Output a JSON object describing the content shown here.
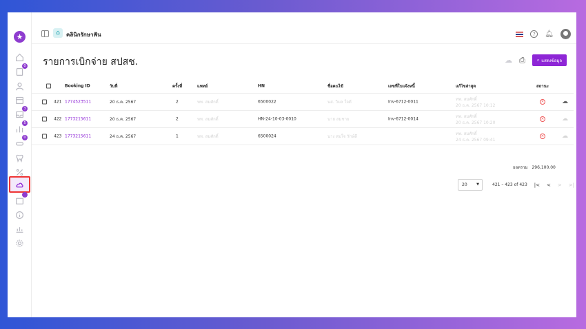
{
  "app": {
    "clinic_name": "คลินิกรักษาฟัน",
    "logo_glyph": "★",
    "clinic_icon": "⌂"
  },
  "sidebar": {
    "items": [
      {
        "icon": "home-icon",
        "badge": ""
      },
      {
        "icon": "document-icon",
        "badge": "0"
      },
      {
        "icon": "user-icon",
        "badge": ""
      },
      {
        "icon": "calendar-icon",
        "badge": ""
      },
      {
        "icon": "inbox-icon",
        "badge": "3"
      },
      {
        "icon": "chart-icon",
        "badge": "5"
      },
      {
        "icon": "pill-icon",
        "badge": "0"
      },
      {
        "icon": "tooth-icon",
        "badge": ""
      },
      {
        "icon": "percent-icon",
        "badge": ""
      },
      {
        "icon": "cloud-icon",
        "badge": "",
        "active": true
      },
      {
        "icon": "box-icon",
        "badge": ""
      },
      {
        "icon": "info-icon",
        "badge": ""
      },
      {
        "icon": "report-icon",
        "badge": ""
      },
      {
        "icon": "settings-icon",
        "badge": ""
      }
    ]
  },
  "page": {
    "title": "รายการเบิกจ่าย สปสช.",
    "search_label": "แสดงข้อมูล"
  },
  "table": {
    "headers": {
      "booking_id": "Booking ID",
      "date": "วันที่",
      "visit": "ครั้งที่",
      "doctor": "แพทย์",
      "hn": "HN",
      "patient": "ชื่อคนไข้",
      "invoice": "เลขที่ใบแจ้งหนี้",
      "last_edit": "แก้ไขล่าสุด",
      "status": "สถานะ"
    },
    "rows": [
      {
        "no": "421",
        "booking_id": "1774523511",
        "date": "20 ธ.ค. 2567",
        "visit": "2",
        "doctor": "ทพ. สมศักดิ์",
        "hn": "6500022",
        "patient": "นส. วิมล ใจดี",
        "invoice": "Inv-6712-0011",
        "last_edit_1": "ทพ. สมศักดิ์",
        "last_edit_2": "20 ธ.ค. 2567 10:12",
        "download_enabled": true
      },
      {
        "no": "422",
        "booking_id": "1773215611",
        "date": "20 ธ.ค. 2567",
        "visit": "2",
        "doctor": "ทพ. สมศักดิ์",
        "hn": "HN-24-10-03-0010",
        "patient": "นาย สมชาย",
        "invoice": "Inv-6712-0014",
        "last_edit_1": "ทพ. สมศักดิ์",
        "last_edit_2": "20 ธ.ค. 2567 10:20",
        "download_enabled": false
      },
      {
        "no": "423",
        "booking_id": "1773215611",
        "date": "24 ธ.ค. 2567",
        "visit": "1",
        "doctor": "ทพ. สมศักดิ์",
        "hn": "6500024",
        "patient": "นาง สมใจ รักษ์ดี",
        "invoice": "",
        "last_edit_1": "ทพ. สมศักดิ์",
        "last_edit_2": "24 ธ.ค. 2567 09:41",
        "download_enabled": false
      }
    ],
    "total_label": "ยอดรวม",
    "total_value": "296,100.00"
  },
  "pagination": {
    "page_size": "20",
    "range": "421 – 423 of 423"
  },
  "colors": {
    "accent": "#8e26d6",
    "danger": "#e55555"
  }
}
